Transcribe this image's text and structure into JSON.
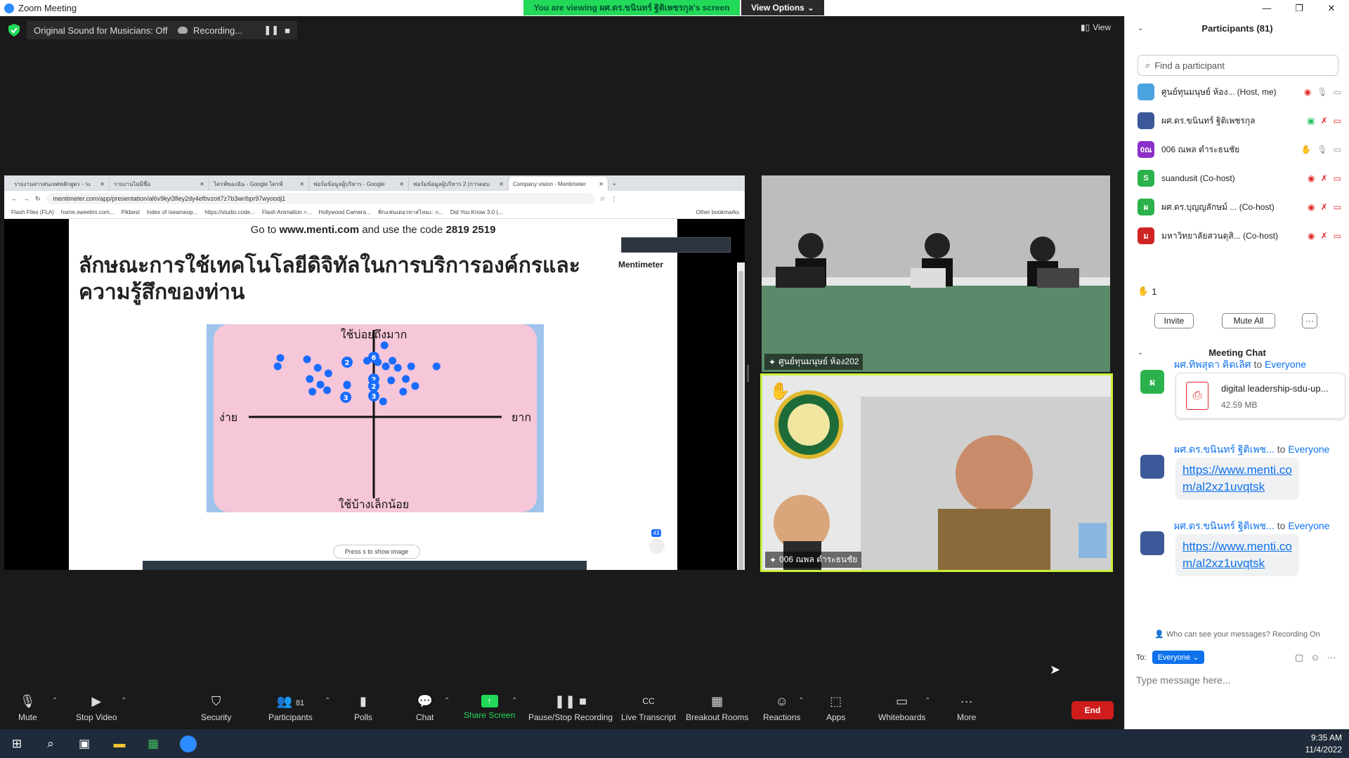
{
  "window": {
    "title": "Zoom Meeting",
    "viewing_banner": "You are viewing ผศ.ดร.ขนินทร์ ฐิติเพชรกุล's screen",
    "view_options": "View Options"
  },
  "status_bar": {
    "original_sound": "Original Sound for Musicians: Off",
    "recording": "Recording...",
    "view_label": "View"
  },
  "browser": {
    "tabs": [
      {
        "label": "รายงานสารสนเทศหลักสูตร - ระ"
      },
      {
        "label": "รายงานไม่มีชื่อ"
      },
      {
        "label": "ไดรฟ์ของฉัน - Google ไดรฟ์"
      },
      {
        "label": "ฟอร์มข้อมูลผู้บริหาร - Google"
      },
      {
        "label": "ฟอร์มข้อมูลผู้บริหาร 2 (การตอบ"
      },
      {
        "label": "Company vision - Mentimeter"
      }
    ],
    "url": "mentimeter.com/app/presentation/al6v9kyi3fiey2dy4efbvzoti7z7b3wr/bpr97wyoodj1",
    "bookmarks": [
      "Flash Files (FLA)",
      "home.sweetim.com...",
      "Pikbest",
      "Index of /seameop...",
      "https://studio.code...",
      "Flash Animation >...",
      "Hollywood Camera...",
      "ฟักแฟนเดอรทาสไหมะ: ก...",
      "Did You Know 3.0 (...",
      "Other bookmarks"
    ]
  },
  "slide": {
    "code_prefix": "Go to",
    "site": "www.menti.com",
    "code_mid": "and use the code",
    "code": "2819 2519",
    "title": "ลักษณะการใช้เทคโนโลยีดิจิทัลในการบริการองค์กรและความรู้สึกของท่าน",
    "brand": "Mentimeter",
    "press_hint": "Press  s  to show image",
    "response_count": "43"
  },
  "chart_data": {
    "type": "scatter",
    "title": "",
    "xlabel_left": "ง่าย",
    "xlabel_right": "ยาก",
    "ylabel_top": "ใช้บ่อยถึงมาก",
    "ylabel_bottom": "ใช้บ้างเล็กน้อย",
    "xlim": [
      -1,
      1
    ],
    "ylim": [
      -1,
      1
    ],
    "points": [
      {
        "x": -0.7,
        "y": 0.84
      },
      {
        "x": -0.72,
        "y": 0.72
      },
      {
        "x": -0.5,
        "y": 0.82
      },
      {
        "x": -0.42,
        "y": 0.7
      },
      {
        "x": -0.34,
        "y": 0.62
      },
      {
        "x": -0.48,
        "y": 0.54
      },
      {
        "x": -0.4,
        "y": 0.46
      },
      {
        "x": -0.35,
        "y": 0.38
      },
      {
        "x": -0.46,
        "y": 0.36
      },
      {
        "x": -0.2,
        "y": 0.46
      },
      {
        "x": -0.2,
        "y": 0.78,
        "label": "2"
      },
      {
        "x": -0.21,
        "y": 0.28,
        "label": "3"
      },
      {
        "x": 0.0,
        "y": 0.85,
        "label": "6"
      },
      {
        "x": 0.08,
        "y": 1.02
      },
      {
        "x": -0.05,
        "y": 0.8
      },
      {
        "x": 0.03,
        "y": 0.78
      },
      {
        "x": 0.14,
        "y": 0.8
      },
      {
        "x": 0.09,
        "y": 0.72
      },
      {
        "x": 0.18,
        "y": 0.7
      },
      {
        "x": 0.28,
        "y": 0.72
      },
      {
        "x": 0.13,
        "y": 0.52
      },
      {
        "x": 0.24,
        "y": 0.54
      },
      {
        "x": 0.31,
        "y": 0.44
      },
      {
        "x": 0.22,
        "y": 0.36
      },
      {
        "x": 0.07,
        "y": 0.22
      },
      {
        "x": 0.0,
        "y": 0.54,
        "label": "2"
      },
      {
        "x": 0.0,
        "y": 0.44,
        "label": "2"
      },
      {
        "x": 0.0,
        "y": 0.3,
        "label": "3"
      },
      {
        "x": 0.47,
        "y": 0.72
      },
      {
        "x": -0.2,
        "y": 0.45
      }
    ]
  },
  "videos": [
    {
      "name": "ศูนย์ทุนมนุษย์ ห้อง202"
    },
    {
      "name": "006 ณพล ตำระธนชัย"
    }
  ],
  "participants_panel": {
    "title": "Participants (81)",
    "search_placeholder": "Find a participant",
    "participants": [
      {
        "name": "ศูนย์ทุนมนุษย์ ห้อง...  (Host, me)",
        "avatar_text": "",
        "color": "#4aa3df"
      },
      {
        "name": "ผศ.ดร.ขนินทร์ ฐิติเพชรกุล",
        "avatar_text": "",
        "color": "#3b5998"
      },
      {
        "name": "006 ณพล ตำระธนชัย",
        "avatar_text": "0ณ",
        "color": "#8b2fc9"
      },
      {
        "name": "suandusit (Co-host)",
        "avatar_text": "S",
        "color": "#2bb24c"
      },
      {
        "name": "ผศ.ดร.บุญญลักษม์ ... (Co-host)",
        "avatar_text": "ผ",
        "color": "#2bb24c"
      },
      {
        "name": "มหาวิทยาลัยสวนดุสิ... (Co-host)",
        "avatar_text": "ม",
        "color": "#d02424"
      }
    ],
    "raised_hands": "1",
    "invite": "Invite",
    "mute_all": "Mute All",
    "more": "···"
  },
  "chat": {
    "title": "Meeting Chat",
    "messages": [
      {
        "sender": "ผศ.ทิพสุดา คิดเลิศ",
        "to": "to",
        "recipient": "Everyone",
        "avatar_text": "ผ",
        "file_name": "digital leadership-sdu-up...",
        "file_size": "42.59 MB"
      },
      {
        "sender": "ผศ.ดร.ขนินทร์ ฐิติเพช...",
        "to": "to",
        "recipient": "Everyone",
        "link": "https://www.menti.com/al2xz1uvqtsk"
      },
      {
        "sender": "ผศ.ดร.ขนินทร์ ฐิติเพช...",
        "to": "to",
        "recipient": "Everyone",
        "link": "https://www.menti.com/al2xz1uvqtsk"
      }
    ],
    "who_can_see": "Who can see your messages? Recording On",
    "to_label": "To:",
    "recipient_selected": "Everyone",
    "placeholder": "Type message here..."
  },
  "toolbar": {
    "mute": "Mute",
    "stop_video": "Stop Video",
    "security": "Security",
    "participants": "Participants",
    "participants_count": "81",
    "polls": "Polls",
    "chat": "Chat",
    "share_screen": "Share Screen",
    "pause_stop_recording": "Pause/Stop Recording",
    "live_transcript": "Live Transcript",
    "breakout_rooms": "Breakout Rooms",
    "reactions": "Reactions",
    "apps": "Apps",
    "whiteboards": "Whiteboards",
    "more": "More",
    "end": "End"
  },
  "taskbar": {
    "time": "9:35 AM",
    "date": "11/4/2022"
  },
  "colors": {
    "accent": "#0e72ed",
    "share_green": "#23d959",
    "end_red": "#cf1c1c",
    "active_speaker": "#c9f03b",
    "menti_blue": "#196cff",
    "quad_pink": "#f6c6d9"
  }
}
